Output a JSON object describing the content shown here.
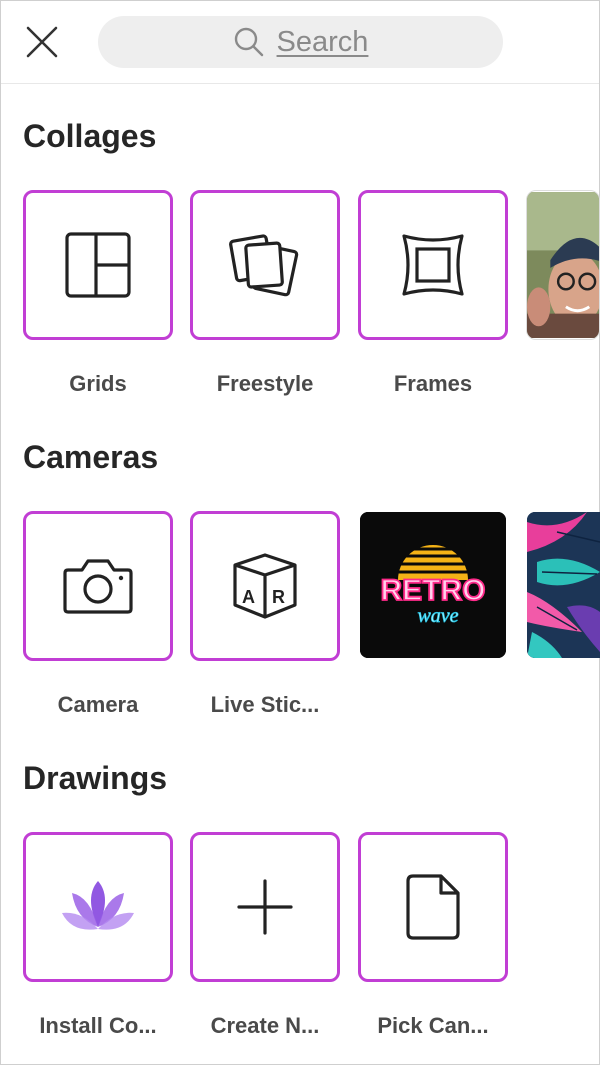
{
  "search": {
    "placeholder": "Search"
  },
  "sections": {
    "collages": {
      "title": "Collages",
      "items": [
        {
          "label": "Grids",
          "icon": "grid-layout-icon"
        },
        {
          "label": "Freestyle",
          "icon": "freestyle-layers-icon"
        },
        {
          "label": "Frames",
          "icon": "frame-icon"
        },
        {
          "label": "",
          "icon": "photo-thumbnail"
        }
      ]
    },
    "cameras": {
      "title": "Cameras",
      "items": [
        {
          "label": "Camera",
          "icon": "camera-icon"
        },
        {
          "label": "Live Stic...",
          "icon": "ar-cube-icon"
        },
        {
          "label": "",
          "icon": "retro-wave-thumbnail",
          "thumb_text": "RETRO",
          "thumb_subtext": "wave"
        },
        {
          "label": "",
          "icon": "palm-leaves-thumbnail"
        }
      ]
    },
    "drawings": {
      "title": "Drawings",
      "items": [
        {
          "label": "Install Co...",
          "icon": "lotus-icon"
        },
        {
          "label": "Create N...",
          "icon": "plus-icon"
        },
        {
          "label": "Pick Can...",
          "icon": "file-icon"
        }
      ]
    }
  },
  "colors": {
    "tile_border": "#c13ed4",
    "lotus": "#8b4fe0"
  }
}
